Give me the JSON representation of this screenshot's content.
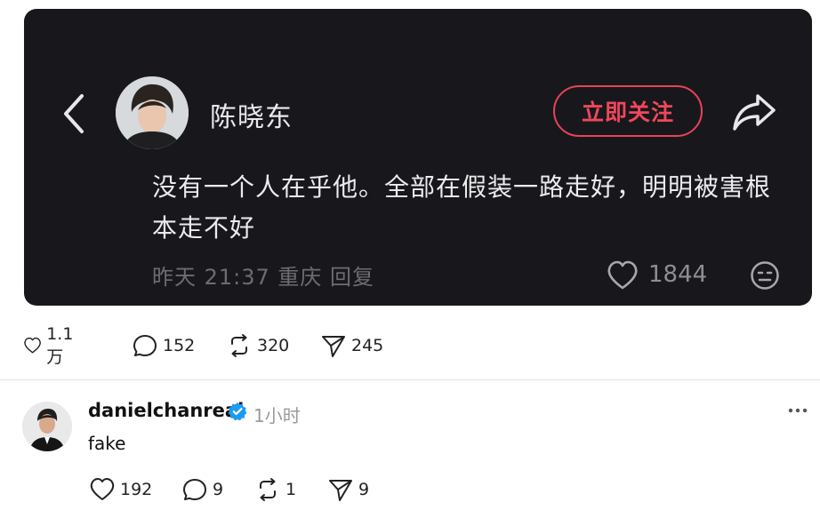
{
  "embedded": {
    "author_name": "陈晓东",
    "follow_label": "立即关注",
    "comment_text": "没有一个人在乎他。全部在假装一路走好，明明被害根本走不好",
    "meta": "昨天 21:37 重庆 回复",
    "like_count": "1844"
  },
  "post_actions": {
    "likes": "1.1 万",
    "comments": "152",
    "reposts": "320",
    "shares": "245"
  },
  "reply": {
    "username": "danielchanreal",
    "time": "1小时",
    "text": "fake",
    "likes": "192",
    "comments": "9",
    "reposts": "1",
    "shares": "9"
  },
  "colors": {
    "card_bg": "#18181c",
    "follow_red": "#f0475b",
    "verified_blue": "#1d9bf0"
  }
}
